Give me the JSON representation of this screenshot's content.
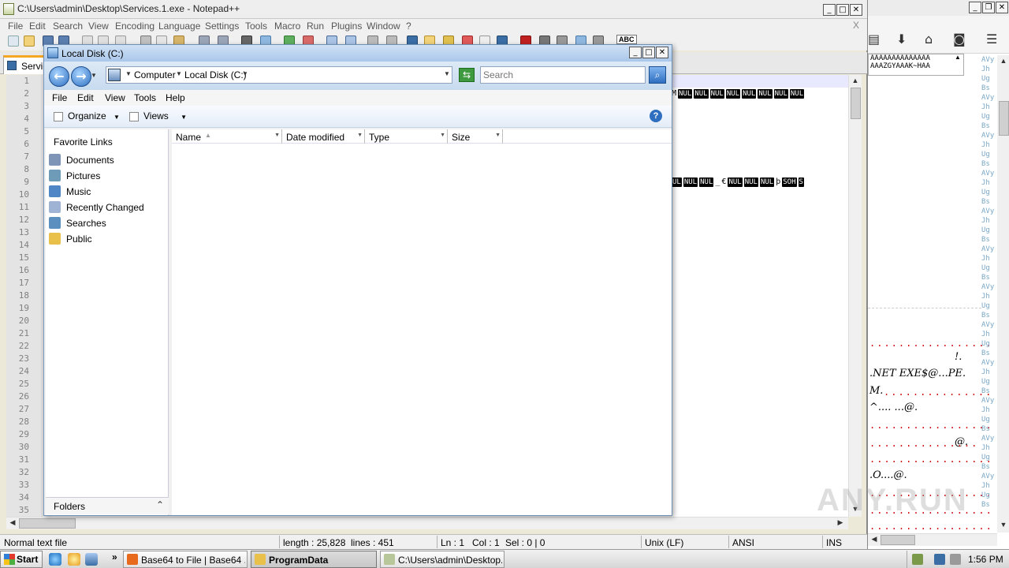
{
  "npp": {
    "title": "C:\\Users\\admin\\Desktop\\Services.1.exe - Notepad++",
    "menu": [
      "File",
      "Edit",
      "Search",
      "View",
      "Encoding",
      "Language",
      "Settings",
      "Tools",
      "Macro",
      "Run",
      "Plugins",
      "Window",
      "?"
    ],
    "close_doc": "X",
    "toolbar_abc": "ABC",
    "tab_label": "Servic",
    "line_numbers": [
      "1",
      "2",
      "3",
      "4",
      "5",
      "6",
      "7",
      "8",
      "9",
      "10",
      "11",
      "12",
      "13",
      "14",
      "15",
      "16",
      "17",
      "18",
      "19",
      "20",
      "21",
      "22",
      "23",
      "24",
      "25",
      "26",
      "27",
      "28",
      "29",
      "30",
      "31",
      "32",
      "33",
      "34",
      "35"
    ],
    "line2_prefix": "M",
    "line2_tokens": [
      "NUL",
      "NUL",
      "NUL",
      "NUL",
      "NUL",
      "NUL",
      "NUL",
      "NUL"
    ],
    "line9": {
      "tokens_a": [
        "UL",
        "NUL",
        "NUL"
      ],
      "plain_a": "_",
      "plain_b": "€",
      "tokens_b": [
        "NUL",
        "NUL",
        "NUL"
      ],
      "plain_c": "þ",
      "tokens_c": [
        "SOH",
        "S"
      ]
    },
    "status": {
      "file_type": "Normal text file",
      "length": "length : 25,828",
      "lines": "lines : 451",
      "ln": "Ln : 1",
      "col": "Col : 1",
      "sel": "Sel : 0 | 0",
      "eol": "Unix (LF)",
      "encoding": "ANSI",
      "mode": "INS"
    }
  },
  "browser": {
    "dropdown_line1": "AAAAAAAAAAAAAA",
    "dropdown_line2": "AAAZGYAAAK~HAA",
    "hex_texts": [
      ".NET EXE$@...PE.",
      "M.",
      "^....  ...@.",
      "@.",
      ".O....@.",
      "!."
    ],
    "side_texts": [
      "AVy",
      "Jh",
      "Ug",
      "Bs",
      "AVy",
      "Jh",
      "Ug",
      "Bs",
      "AVy",
      "Jh",
      "Ug",
      "Bs",
      "AVy",
      "Jh",
      "Ug",
      "Bs",
      "AVy",
      "Jh",
      "Ug",
      "Bs",
      "AVy",
      "Jh",
      "Ug",
      "Bs",
      "AVy",
      "Jh",
      "Ug",
      "Bs",
      "AVy",
      "Jh",
      "Ug",
      "Bs",
      "AVy",
      "Jh",
      "Ug",
      "Bs",
      "AVy",
      "Jh",
      "Ug",
      "Bs",
      "AVy",
      "Jh",
      "Ug",
      "Bs",
      "AVy",
      "Jh",
      "Ug",
      "Bs"
    ]
  },
  "explorer": {
    "title": "Local Disk (C:)",
    "breadcrumb": [
      "Computer",
      "Local Disk (C:)"
    ],
    "search_placeholder": "Search",
    "menu": [
      "File",
      "Edit",
      "View",
      "Tools",
      "Help"
    ],
    "organize": "Organize",
    "views": "Views",
    "help": "?",
    "favorite_header": "Favorite Links",
    "favorites": [
      {
        "label": "Documents",
        "color": "#7e95b8"
      },
      {
        "label": "Pictures",
        "color": "#6e9bb8"
      },
      {
        "label": "Music",
        "color": "#4f86c6"
      },
      {
        "label": "Recently Changed",
        "color": "#9fb4d4"
      },
      {
        "label": "Searches",
        "color": "#5a8fbf"
      },
      {
        "label": "Public",
        "color": "#e8c04a"
      }
    ],
    "folders_label": "Folders",
    "columns": [
      "Name",
      "Date modified",
      "Type",
      "Size"
    ]
  },
  "taskbar": {
    "start": "Start",
    "more": "»",
    "tasks": [
      {
        "label": "Base64 to File | Base64 ...",
        "color": "#e86a1c"
      },
      {
        "label": "ProgramData",
        "color": "#e8c04a"
      },
      {
        "label": "C:\\Users\\admin\\Desktop...",
        "color": "#b7c79a"
      }
    ],
    "clock": "1:56 PM"
  },
  "watermark": "ANY.RUN"
}
